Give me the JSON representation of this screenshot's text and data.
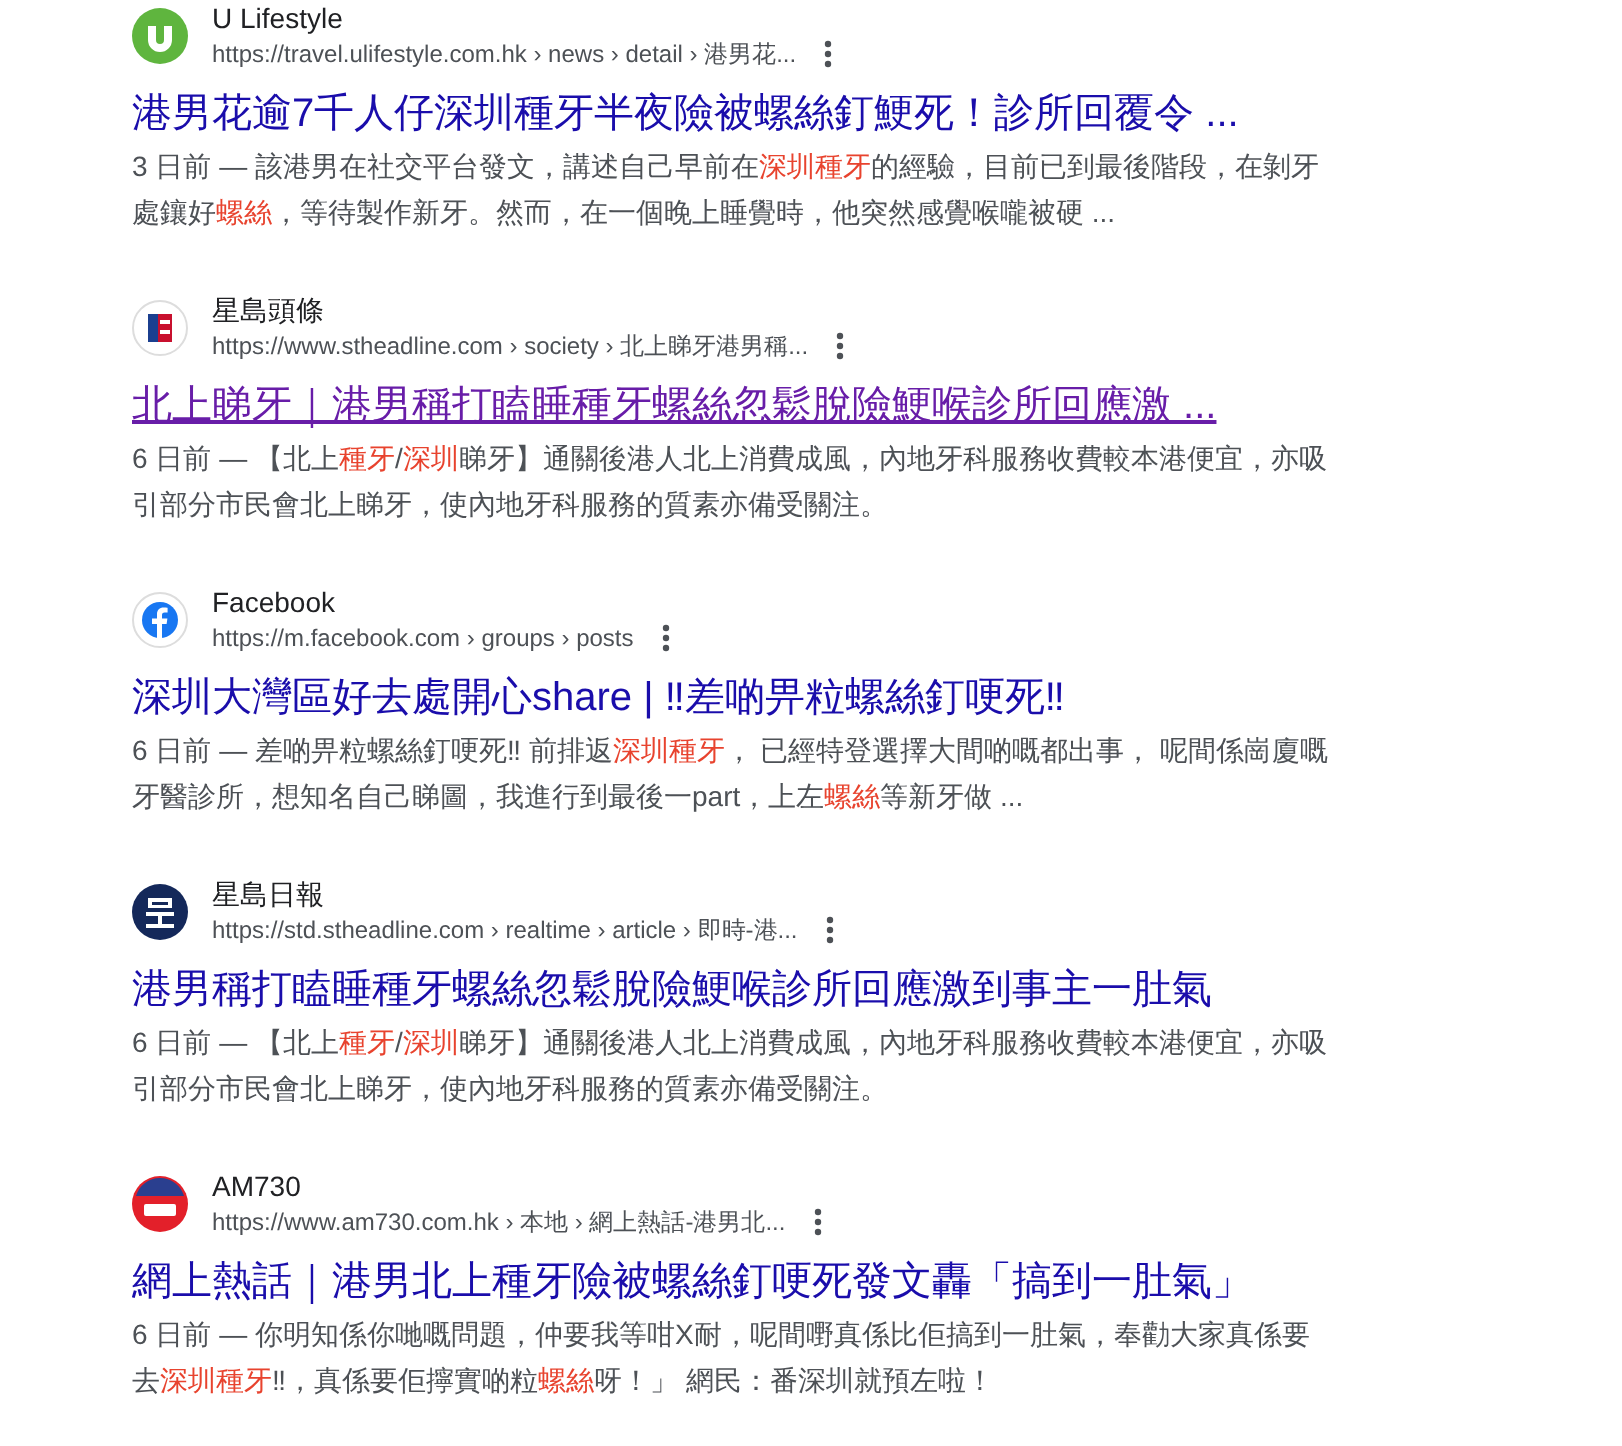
{
  "results": [
    {
      "kind": "ulifestyle",
      "site": "U Lifestyle",
      "url": "https://travel.ulifestyle.com.hk › news › detail › 港男花...",
      "title": "港男花逾7千人仔深圳種牙半夜險被螺絲釘鯁死！診所回覆令 ...",
      "visited": false,
      "hovered": false,
      "snippet": "3 日前 — 該港男在社交平台發文，講述自己早前在**深圳種牙**的經驗，目前已到最後階段，在剝牙處鑲好**螺絲**，等待製作新牙。然而，在一個晚上睡覺時，他突然感覺喉嚨被硬 ..."
    },
    {
      "kind": "stheadline",
      "site": "星島頭條",
      "url": "https://www.stheadline.com › society › 北上睇牙港男稱...",
      "title": "北上睇牙｜港男稱打瞌睡種牙螺絲忽鬆脫險鯁喉診所回應激 ...",
      "visited": true,
      "hovered": true,
      "snippet": "6 日前 — 【北上**種牙**/**深圳**睇牙】通關後港人北上消費成風，內地牙科服務收費較本港便宜，亦吸引部分市民會北上睇牙，使內地牙科服務的質素亦備受關注。"
    },
    {
      "kind": "facebook",
      "site": "Facebook",
      "url": "https://m.facebook.com › groups › posts",
      "title": "深圳大灣區好去處開心share | ‼差啲畀粒螺絲釘哽死‼",
      "visited": false,
      "hovered": false,
      "snippet": "6 日前 — 差啲畀粒螺絲釘哽死‼ 前排返**深圳種牙**， 已經特登選擇大間啲嘅都出事， 呢間係崗廈嘅牙醫診所，想知名自己睇圖，我進行到最後一part，上左**螺絲**等新牙做 ..."
    },
    {
      "kind": "std",
      "site": "星島日報",
      "url": "https://std.stheadline.com › realtime › article › 即時-港...",
      "title": "港男稱打瞌睡種牙螺絲忽鬆脫險鯁喉診所回應激到事主一肚氣",
      "visited": false,
      "hovered": false,
      "snippet": "6 日前 — 【北上**種牙**/**深圳**睇牙】通關後港人北上消費成風，內地牙科服務收費較本港便宜，亦吸引部分市民會北上睇牙，使內地牙科服務的質素亦備受關注。"
    },
    {
      "kind": "am730",
      "site": "AM730",
      "url": "https://www.am730.com.hk › 本地 › 網上熱話-港男北...",
      "title": "網上熱話｜港男北上種牙險被螺絲釘哽死發文轟「搞到一肚氣」",
      "visited": false,
      "hovered": false,
      "snippet": "6 日前 — 你明知係你哋嘅問題，仲要我等咁X耐，呢間嘢真係比佢搞到一肚氣，奉勸大家真係要去**深圳種牙**‼，真係要佢擰實啲粒**螺絲**呀！」 網民：番深圳就預左啦！"
    }
  ]
}
